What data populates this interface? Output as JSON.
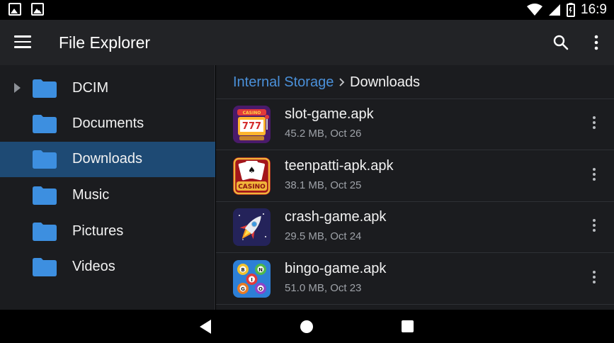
{
  "status_bar": {
    "time": "16:9",
    "left_icons": [
      "image-icon",
      "photo-icon"
    ],
    "right_icons": [
      "wifi-icon",
      "signal-icon",
      "battery-icon"
    ]
  },
  "toolbar": {
    "title": "File Explorer",
    "menu_icon": "hamburger-menu-icon",
    "search_icon": "search-icon",
    "more_icon": "more-vert-icon"
  },
  "sidebar": {
    "items": [
      {
        "label": "DCIM",
        "expandable": true,
        "selected": false
      },
      {
        "label": "Documents",
        "expandable": false,
        "selected": false
      },
      {
        "label": "Downloads",
        "expandable": false,
        "selected": true
      },
      {
        "label": "Music",
        "expandable": false,
        "selected": false
      },
      {
        "label": "Pictures",
        "expandable": false,
        "selected": false
      },
      {
        "label": "Videos",
        "expandable": false,
        "selected": false
      }
    ]
  },
  "breadcrumb": {
    "root": "Internal Storage",
    "current": "Downloads"
  },
  "files": [
    {
      "name": "slot-game.apk",
      "meta": "45.2 MB, Oct 26",
      "icon": "slot-machine-icon",
      "icon_text": "777"
    },
    {
      "name": "teenpatti-apk.apk",
      "meta": "38.1 MB, Oct 25",
      "icon": "casino-cards-icon",
      "icon_text": "CASINO"
    },
    {
      "name": "crash-game.apk",
      "meta": "29.5 MB, Oct 24",
      "icon": "rocket-icon",
      "icon_text": ""
    },
    {
      "name": "bingo-game.apk",
      "meta": "51.0 MB, Oct 23",
      "icon": "bingo-balls-icon",
      "icon_text": [
        "B",
        "I",
        "N",
        "G",
        "O"
      ]
    }
  ],
  "colors": {
    "accent": "#4a90d9",
    "folder": "#3d8fe0",
    "selected_bg": "#1e4a74",
    "toolbar_bg": "#222326",
    "pane_bg": "#1b1c1f"
  }
}
